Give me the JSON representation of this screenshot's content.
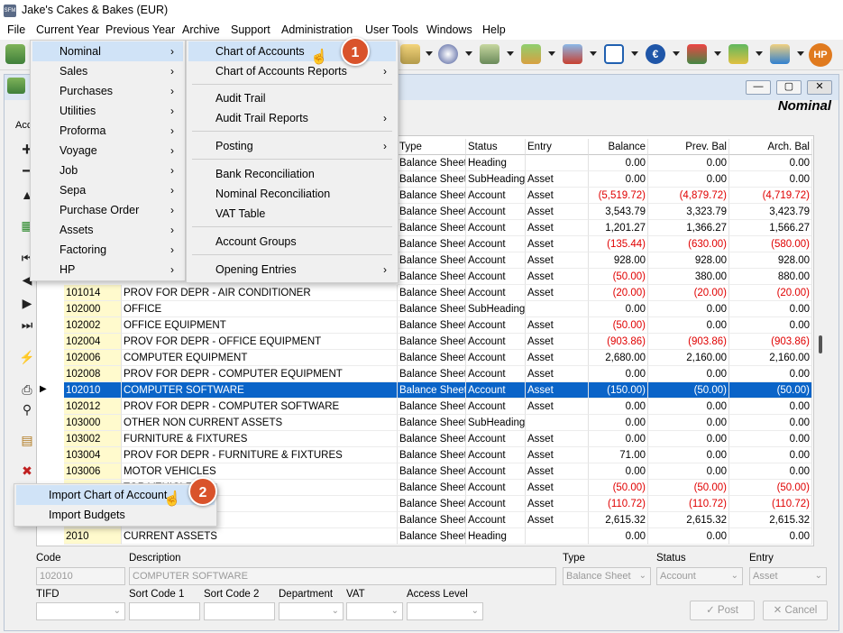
{
  "app": {
    "title": "Jake's Cakes & Bakes (EUR)",
    "icon": "SFM"
  },
  "menubar": [
    "File",
    "Current Year",
    "Previous Year",
    "Archive",
    "Support",
    "Administration",
    "User Tools",
    "Windows",
    "Help"
  ],
  "window": {
    "subtitle": "Nominal",
    "acc_label": "Acc",
    "min": "—",
    "max": "▢",
    "close": "✕"
  },
  "toolbar": {
    "hp": "HP"
  },
  "grid": {
    "headers": {
      "type": "Type",
      "status": "Status",
      "entry": "Entry",
      "balance": "Balance",
      "prev": "Prev. Bal",
      "arch": "Arch. Bal"
    },
    "upper_rows": [
      {
        "type": "Balance Sheet",
        "status": "Heading",
        "entry": "",
        "balance": "0.00",
        "prev": "0.00",
        "arch": "0.00",
        "neg": false
      },
      {
        "type": "Balance Sheet",
        "status": "SubHeading",
        "entry": "Asset",
        "balance": "0.00",
        "prev": "0.00",
        "arch": "0.00",
        "neg": false
      },
      {
        "type": "Balance Sheet",
        "status": "Account",
        "entry": "Asset",
        "balance": "(5,519.72)",
        "prev": "(4,879.72)",
        "arch": "(4,719.72)",
        "neg": true
      },
      {
        "type": "Balance Sheet",
        "status": "Account",
        "entry": "Asset",
        "balance": "3,543.79",
        "prev": "3,323.79",
        "arch": "3,423.79",
        "neg": false
      },
      {
        "type": "Balance Sheet",
        "status": "Account",
        "entry": "Asset",
        "balance": "1,201.27",
        "prev": "1,366.27",
        "arch": "1,566.27",
        "neg": false
      },
      {
        "type": "Balance Sheet",
        "status": "Account",
        "entry": "Asset",
        "balance": "(135.44)",
        "prev": "(630.00)",
        "arch": "(580.00)",
        "neg": true
      },
      {
        "type": "Balance Sheet",
        "status": "Account",
        "entry": "Asset",
        "balance": "928.00",
        "prev": "928.00",
        "arch": "928.00",
        "neg": false
      },
      {
        "type": "Balance Sheet",
        "status": "Account",
        "entry": "Asset",
        "balance": "(50.00)",
        "prev": "380.00",
        "arch": "880.00",
        "neg": true
      }
    ],
    "rows": [
      {
        "code": "101014",
        "desc": "PROV FOR DEPR - AIR CONDITIONER",
        "type": "Balance Sheet",
        "status": "Account",
        "entry": "Asset",
        "balance": "(20.00)",
        "prev": "(20.00)",
        "arch": "(20.00)",
        "neg": true
      },
      {
        "code": "102000",
        "desc": "OFFICE",
        "type": "Balance Sheet",
        "status": "SubHeading",
        "entry": "",
        "balance": "0.00",
        "prev": "0.00",
        "arch": "0.00",
        "neg": false
      },
      {
        "code": "102002",
        "desc": "OFFICE EQUIPMENT",
        "type": "Balance Sheet",
        "status": "Account",
        "entry": "Asset",
        "balance": "(50.00)",
        "prev": "0.00",
        "arch": "0.00",
        "neg": true
      },
      {
        "code": "102004",
        "desc": "PROV FOR DEPR - OFFICE EQUIPMENT",
        "type": "Balance Sheet",
        "status": "Account",
        "entry": "Asset",
        "balance": "(903.86)",
        "prev": "(903.86)",
        "arch": "(903.86)",
        "neg": true
      },
      {
        "code": "102006",
        "desc": "COMPUTER EQUIPMENT",
        "type": "Balance Sheet",
        "status": "Account",
        "entry": "Asset",
        "balance": "2,680.00",
        "prev": "2,160.00",
        "arch": "2,160.00",
        "neg": false
      },
      {
        "code": "102008",
        "desc": "PROV FOR DEPR - COMPUTER EQUIPMENT",
        "type": "Balance Sheet",
        "status": "Account",
        "entry": "Asset",
        "balance": "0.00",
        "prev": "0.00",
        "arch": "0.00",
        "neg": false
      },
      {
        "code": "102010",
        "desc": "COMPUTER SOFTWARE",
        "type": "Balance Sheet",
        "status": "Account",
        "entry": "Asset",
        "balance": "(150.00)",
        "prev": "(50.00)",
        "arch": "(50.00)",
        "neg": true,
        "selected": true
      },
      {
        "code": "102012",
        "desc": "PROV FOR DEPR - COMPUTER SOFTWARE",
        "type": "Balance Sheet",
        "status": "Account",
        "entry": "Asset",
        "balance": "0.00",
        "prev": "0.00",
        "arch": "0.00",
        "neg": false
      },
      {
        "code": "103000",
        "desc": "OTHER NON CURRENT ASSETS",
        "type": "Balance Sheet",
        "status": "SubHeading",
        "entry": "",
        "balance": "0.00",
        "prev": "0.00",
        "arch": "0.00",
        "neg": false
      },
      {
        "code": "103002",
        "desc": "FURNITURE & FIXTURES",
        "type": "Balance Sheet",
        "status": "Account",
        "entry": "Asset",
        "balance": "0.00",
        "prev": "0.00",
        "arch": "0.00",
        "neg": false
      },
      {
        "code": "103004",
        "desc": "PROV FOR DEPR - FURNITURE & FIXTURES",
        "type": "Balance Sheet",
        "status": "Account",
        "entry": "Asset",
        "balance": "71.00",
        "prev": "0.00",
        "arch": "0.00",
        "neg": false
      },
      {
        "code": "103006",
        "desc": "MOTOR VEHICLES",
        "type": "Balance Sheet",
        "status": "Account",
        "entry": "Asset",
        "balance": "0.00",
        "prev": "0.00",
        "arch": "0.00",
        "neg": false
      },
      {
        "code": "",
        "desc": "TOR VEHICLES",
        "type": "Balance Sheet",
        "status": "Account",
        "entry": "Asset",
        "balance": "(50.00)",
        "prev": "(50.00)",
        "arch": "(50.00)",
        "neg": true
      },
      {
        "code": "",
        "desc": "ASSETS",
        "type": "Balance Sheet",
        "status": "Account",
        "entry": "Asset",
        "balance": "(110.72)",
        "prev": "(110.72)",
        "arch": "(110.72)",
        "neg": true
      },
      {
        "code": "",
        "desc": "",
        "type": "Balance Sheet",
        "status": "Account",
        "entry": "Asset",
        "balance": "2,615.32",
        "prev": "2,615.32",
        "arch": "2,615.32",
        "neg": false
      },
      {
        "code": "2010",
        "desc": "CURRENT ASSETS",
        "type": "Balance Sheet",
        "status": "Heading",
        "entry": "",
        "balance": "0.00",
        "prev": "0.00",
        "arch": "0.00",
        "neg": false
      }
    ]
  },
  "menu_current_year": {
    "items": [
      "Nominal",
      "Sales",
      "Purchases",
      "Utilities",
      "Proforma",
      "Voyage",
      "Job",
      "Sepa",
      "Purchase Order",
      "Assets",
      "Factoring",
      "HP"
    ]
  },
  "menu_nominal": {
    "items": [
      {
        "label": "Chart of Accounts",
        "submenu": false
      },
      {
        "label": "Chart of Accounts Reports",
        "submenu": true
      },
      {
        "label": "Audit Trail",
        "submenu": false
      },
      {
        "label": "Audit Trail Reports",
        "submenu": true
      },
      {
        "label": "Posting",
        "submenu": true
      },
      {
        "label": "Bank Reconciliation",
        "submenu": false
      },
      {
        "label": "Nominal Reconciliation",
        "submenu": false
      },
      {
        "label": "VAT Table",
        "submenu": false
      },
      {
        "label": "Account Groups",
        "submenu": false
      },
      {
        "label": "Opening Entries",
        "submenu": true
      }
    ]
  },
  "menu_import": {
    "items": [
      "Import Chart of Account",
      "Import Budgets"
    ]
  },
  "badges": [
    "1",
    "2"
  ],
  "form": {
    "labels": {
      "code": "Code",
      "description": "Description",
      "type": "Type",
      "status": "Status",
      "entry": "Entry",
      "tifd": "TIFD",
      "sort1": "Sort Code 1",
      "sort2": "Sort Code 2",
      "department": "Department",
      "vat": "VAT",
      "access": "Access Level"
    },
    "values": {
      "code": "102010",
      "description": "COMPUTER SOFTWARE",
      "type": "Balance Sheet",
      "status": "Account",
      "entry": "Asset"
    },
    "post": "Post",
    "cancel": "Cancel"
  }
}
